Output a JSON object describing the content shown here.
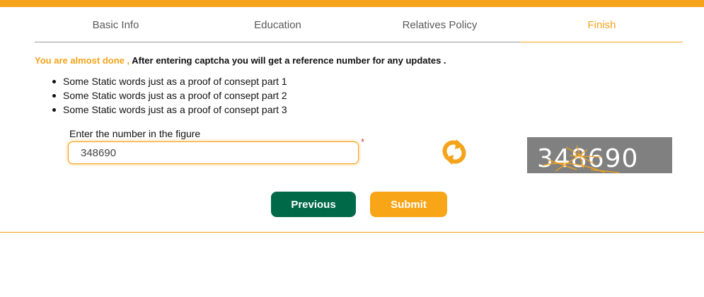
{
  "colors": {
    "accent": "#f5a31a",
    "previous_button": "#006a48",
    "submit_button": "#f9a518"
  },
  "tabs": [
    {
      "label": "Basic Info",
      "active": false
    },
    {
      "label": "Education",
      "active": false
    },
    {
      "label": "Relatives Policy",
      "active": false
    },
    {
      "label": "Finish",
      "active": true
    }
  ],
  "notice": {
    "highlight": "You are almost done ,",
    "text": " After entering captcha you will get a reference number for any updates ."
  },
  "bullets": [
    "Some Static words just as a proof of consept part 1",
    "Some Static words just as a proof of consept part 2",
    "Some Static words just as a proof of consept part 3"
  ],
  "captcha": {
    "label": "Enter the number in the figure",
    "input_value": "348690",
    "required_mark": "*",
    "image_text": "348690",
    "refresh_icon": "refresh-icon"
  },
  "buttons": {
    "previous": "Previous",
    "submit": "Submit"
  }
}
